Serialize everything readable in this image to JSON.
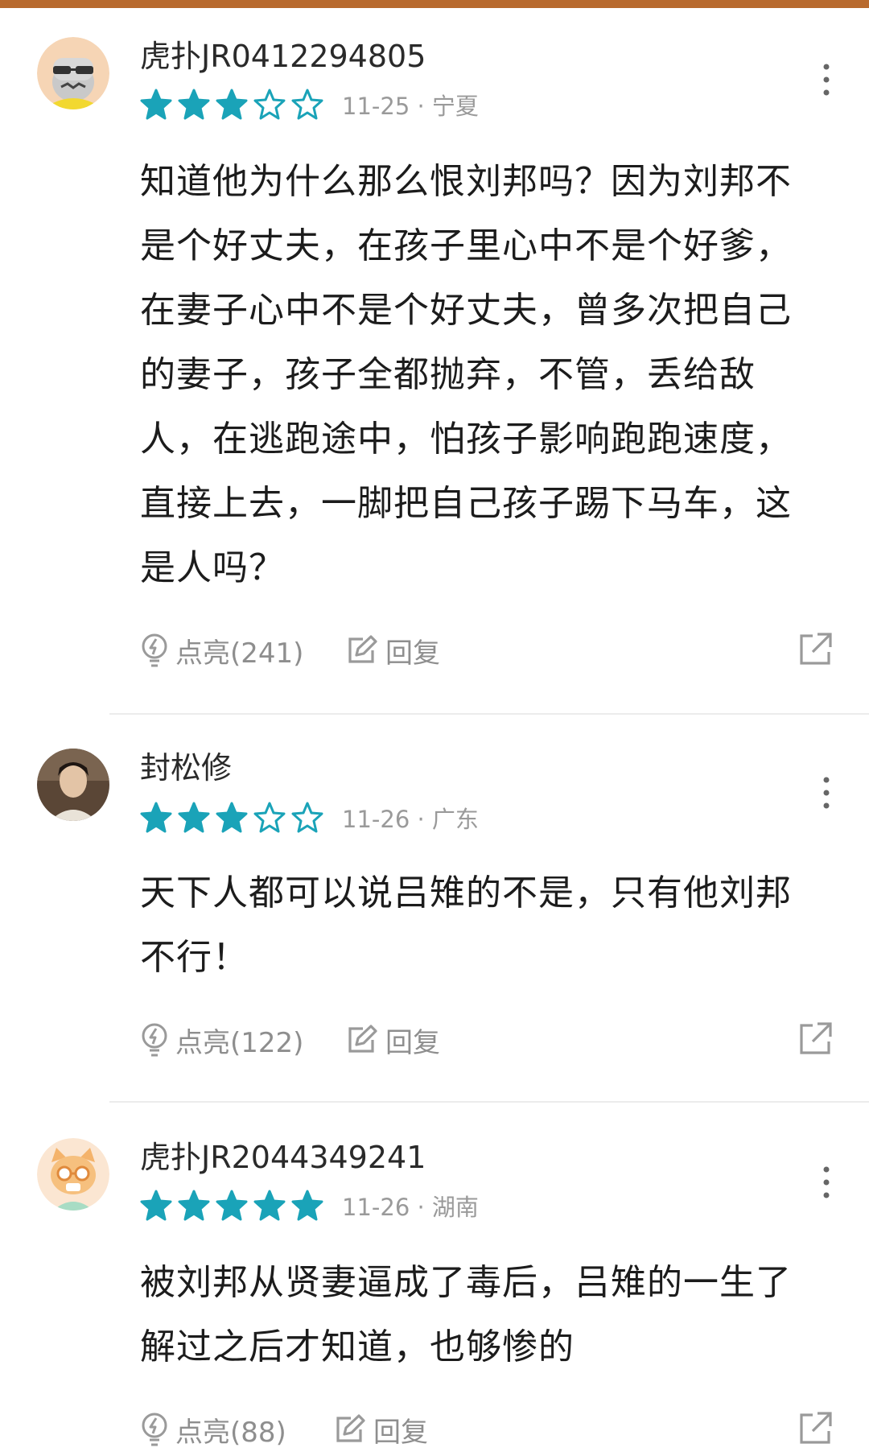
{
  "colors": {
    "top_bar": "#b86a2e",
    "star": "#1aa3b8",
    "meta_text": "#9a9a9a",
    "action_text": "#8e8e8e"
  },
  "comments": [
    {
      "username": "虎扑JR0412294805",
      "rating": 3,
      "max_rating": 5,
      "date": "11-25",
      "location": "宁夏",
      "meta": "11-25 · 宁夏",
      "avatar_icon": "sunglasses-cartoon-avatar-icon",
      "content": "知道他为什么那么恨刘邦吗？因为刘邦不是个好丈夫，在孩子里心中不是个好爹，在妻子心中不是个好丈夫，曾多次把自己的妻子，孩子全都抛弃，不管，丢给敌人，在逃跑途中，怕孩子影响跑跑速度，直接上去，一脚把自己孩子踢下马车，这是人吗？",
      "like_label": "点亮(241)",
      "reply_label": "回复"
    },
    {
      "username": "封松修",
      "rating": 3,
      "max_rating": 5,
      "date": "11-26",
      "location": "广东",
      "meta": "11-26 · 广东",
      "avatar_icon": "photo-avatar-icon",
      "content": "天下人都可以说吕雉的不是，只有他刘邦不行！",
      "like_label": "点亮(122)",
      "reply_label": "回复"
    },
    {
      "username": "虎扑JR2044349241",
      "rating": 5,
      "max_rating": 5,
      "date": "11-26",
      "location": "湖南",
      "meta": "11-26 · 湖南",
      "avatar_icon": "cat-glasses-avatar-icon",
      "content": "被刘邦从贤妻逼成了毒后，吕雉的一生了解过之后才知道，也够惨的",
      "like_label": "点亮(88)",
      "reply_label": "回复"
    }
  ]
}
